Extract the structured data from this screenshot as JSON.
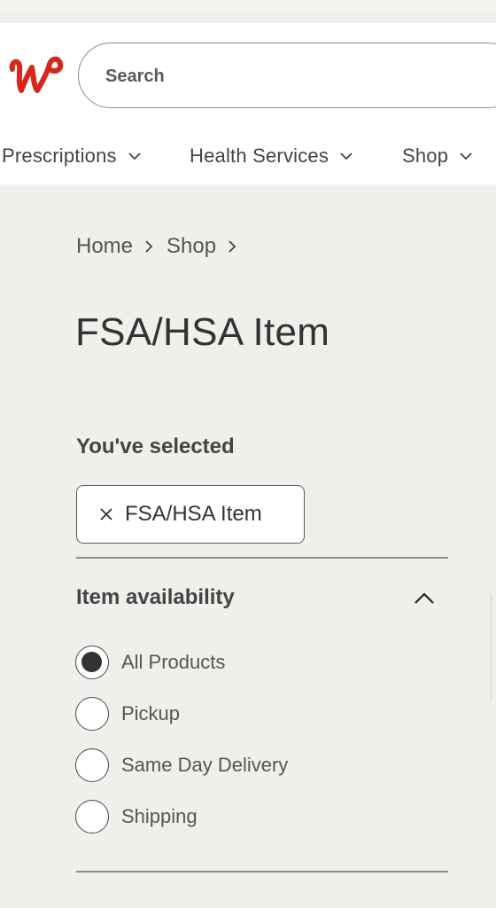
{
  "search": {
    "placeholder": "Search"
  },
  "nav": {
    "items": [
      {
        "label": "Prescriptions"
      },
      {
        "label": "Health Services"
      },
      {
        "label": "Shop"
      }
    ]
  },
  "breadcrumb": {
    "items": [
      "Home",
      "Shop"
    ]
  },
  "page_title": "FSA/HSA Item",
  "selected": {
    "heading": "You've selected",
    "chips": [
      {
        "label": "FSA/HSA Item"
      }
    ]
  },
  "facet": {
    "title": "Item availability",
    "expanded": true,
    "options": [
      {
        "label": "All Products",
        "checked": true
      },
      {
        "label": "Pickup",
        "checked": false
      },
      {
        "label": "Same Day Delivery",
        "checked": false
      },
      {
        "label": "Shipping",
        "checked": false
      }
    ]
  },
  "colors": {
    "brand": "#d9261c",
    "background": "#f1efec"
  },
  "icons": {
    "logo": "walgreens-w-logo",
    "nav_chevron": "chevron-down-icon",
    "crumb": "chevron-right-icon",
    "remove": "close-icon",
    "collapse": "chevron-up-icon"
  }
}
